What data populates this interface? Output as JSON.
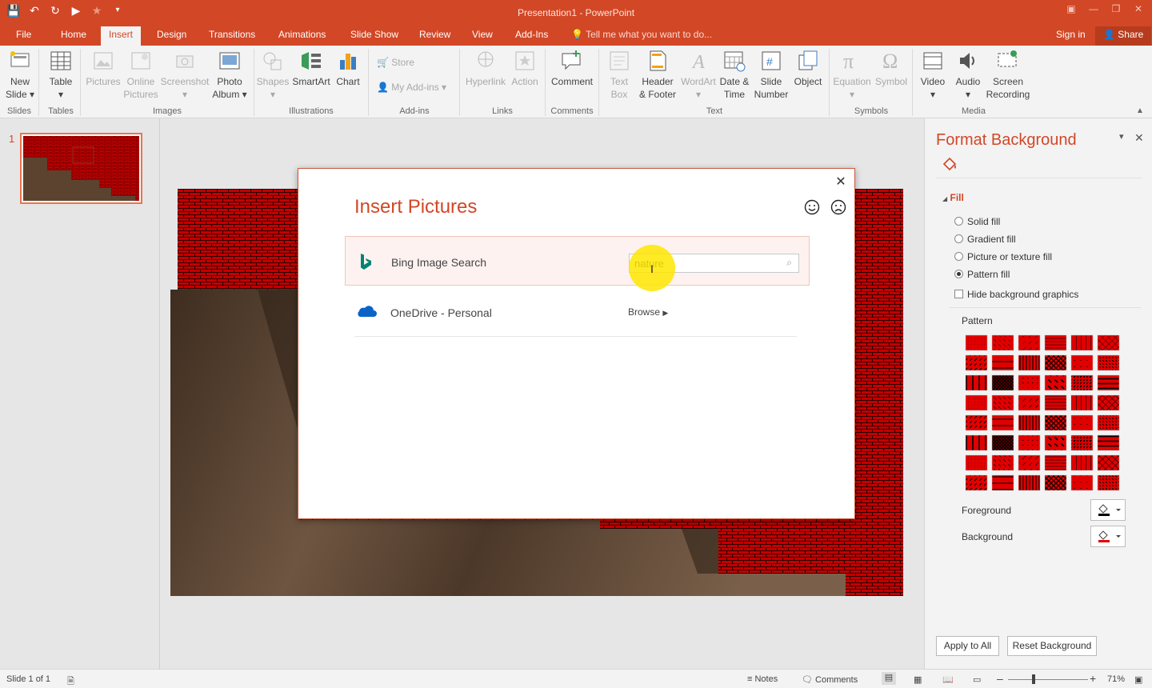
{
  "window": {
    "title": "Presentation1 - PowerPoint"
  },
  "tabs": [
    "File",
    "Home",
    "Insert",
    "Design",
    "Transitions",
    "Animations",
    "Slide Show",
    "Review",
    "View",
    "Add-Ins"
  ],
  "active_tab": "Insert",
  "tell_me": "Tell me what you want to do...",
  "account": {
    "sign_in": "Sign in",
    "share": "Share"
  },
  "ribbon": {
    "new_slide": [
      "New",
      "Slide"
    ],
    "table": "Table",
    "pictures": "Pictures",
    "online_pictures": [
      "Online",
      "Pictures"
    ],
    "screenshot": "Screenshot",
    "photo_album": [
      "Photo",
      "Album"
    ],
    "shapes": "Shapes",
    "smartart": "SmartArt",
    "chart": "Chart",
    "store": "Store",
    "my_addins": "My Add-ins",
    "hyperlink": "Hyperlink",
    "action": "Action",
    "comment": "Comment",
    "text_box": [
      "Text",
      "Box"
    ],
    "header_footer": [
      "Header",
      "& Footer"
    ],
    "wordart": "WordArt",
    "date_time": [
      "Date &",
      "Time"
    ],
    "slide_number": [
      "Slide",
      "Number"
    ],
    "object": "Object",
    "equation": "Equation",
    "symbol": "Symbol",
    "video": "Video",
    "audio": "Audio",
    "screen_recording": [
      "Screen",
      "Recording"
    ],
    "groups": [
      "Slides",
      "Tables",
      "Images",
      "Illustrations",
      "Add-ins",
      "Links",
      "Comments",
      "Text",
      "Symbols",
      "Media"
    ]
  },
  "thumbnails": {
    "slide_number": "1"
  },
  "dialog": {
    "title": "Insert Pictures",
    "bing": {
      "label": "Bing Image Search",
      "search_value": "nature"
    },
    "onedrive": {
      "label": "OneDrive - Personal",
      "browse": "Browse"
    }
  },
  "format_pane": {
    "title": "Format Background",
    "section": "Fill",
    "options": [
      "Solid fill",
      "Gradient fill",
      "Picture or texture fill",
      "Pattern fill"
    ],
    "selected_option": "Pattern fill",
    "hide_graphics": "Hide background graphics",
    "pattern_label": "Pattern",
    "foreground_label": "Foreground",
    "background_label": "Background",
    "apply_all": "Apply to All",
    "reset": "Reset Background",
    "colors": {
      "foreground": "#000000",
      "background": "#e00000"
    }
  },
  "statusbar": {
    "slide_info": "Slide 1 of 1",
    "notes": "Notes",
    "comments": "Comments",
    "zoom": "71%"
  },
  "colors": {
    "accent": "#d24726",
    "slide_pattern": "#c30000"
  }
}
